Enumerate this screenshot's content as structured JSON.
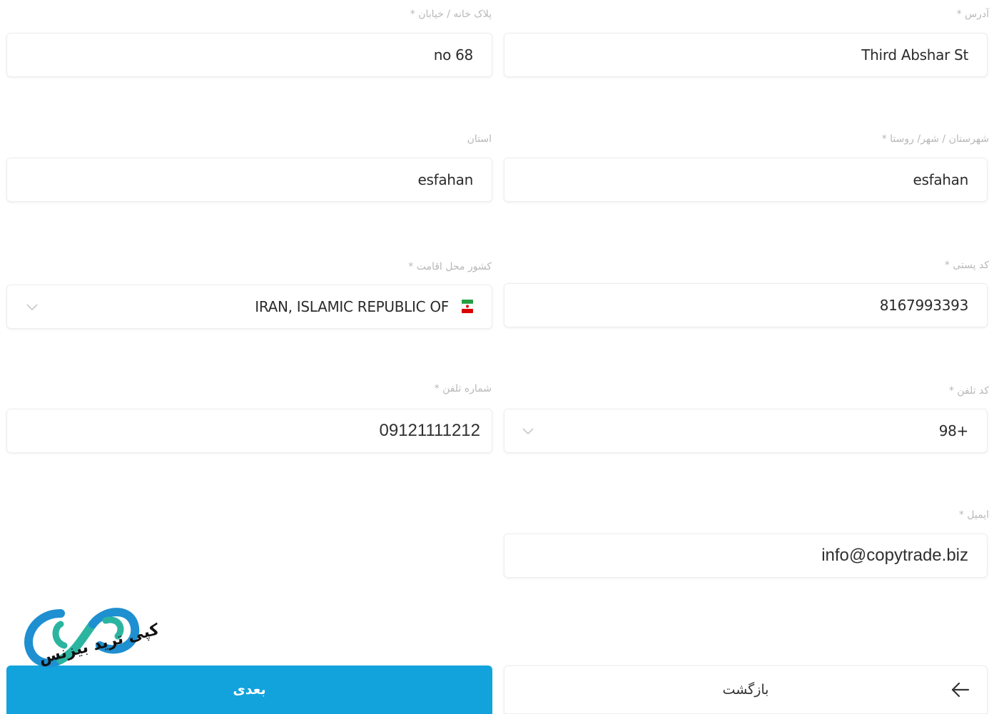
{
  "fields": {
    "address": {
      "label": "آدرس *",
      "value": "Third Abshar St"
    },
    "house_number": {
      "label": "پلاک خانه / خیابان *",
      "value": "no 68"
    },
    "city": {
      "label": "شهرستان / شهر/ روستا *",
      "value": "esfahan"
    },
    "province": {
      "label": "استان",
      "value": "esfahan"
    },
    "postal_code": {
      "label": "کد پستی *",
      "value": "8167993393"
    },
    "country": {
      "label": "کشور محل اقامت *",
      "value": "IRAN, ISLAMIC REPUBLIC OF",
      "icon": "iran-flag-icon"
    },
    "phone_code": {
      "label": "کد تلفن *",
      "value": "98+",
      "icon": "chevron-down-icon"
    },
    "phone_number": {
      "label": "شماره تلفن *",
      "value": "09121111212"
    },
    "email": {
      "label": "ایمیل *",
      "value": "info@copytrade.biz"
    }
  },
  "buttons": {
    "next_label": "بعدی",
    "back_label": "بازگشت",
    "back_icon": "arrow-left-icon"
  },
  "watermark": {
    "text": "کپی ترید بیزنس",
    "icon": "infinity-logo-icon"
  },
  "colors": {
    "primary": "#12a3dd",
    "label": "#b8b8b8",
    "text": "#2b2b2b",
    "logo_blue": "#1e8fd0",
    "logo_teal": "#2bb5a0"
  }
}
